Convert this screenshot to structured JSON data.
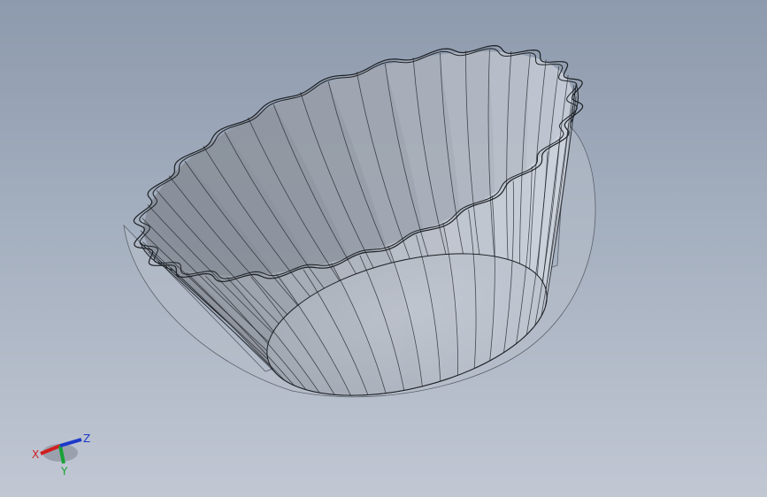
{
  "viewport": {
    "background_top": "#8d9aad",
    "background_bottom": "#c1c7d3"
  },
  "model": {
    "object": "fluted-bowl",
    "display_mode": "shaded-with-edges",
    "body_color": "#a9b1bd",
    "edge_color": "#1c1f24",
    "flute_count": 24
  },
  "triad": {
    "x_label": "X",
    "y_label": "Y",
    "z_label": "Z",
    "x_color": "#d01f1f",
    "y_color": "#17a235",
    "z_color": "#1d39c9"
  }
}
